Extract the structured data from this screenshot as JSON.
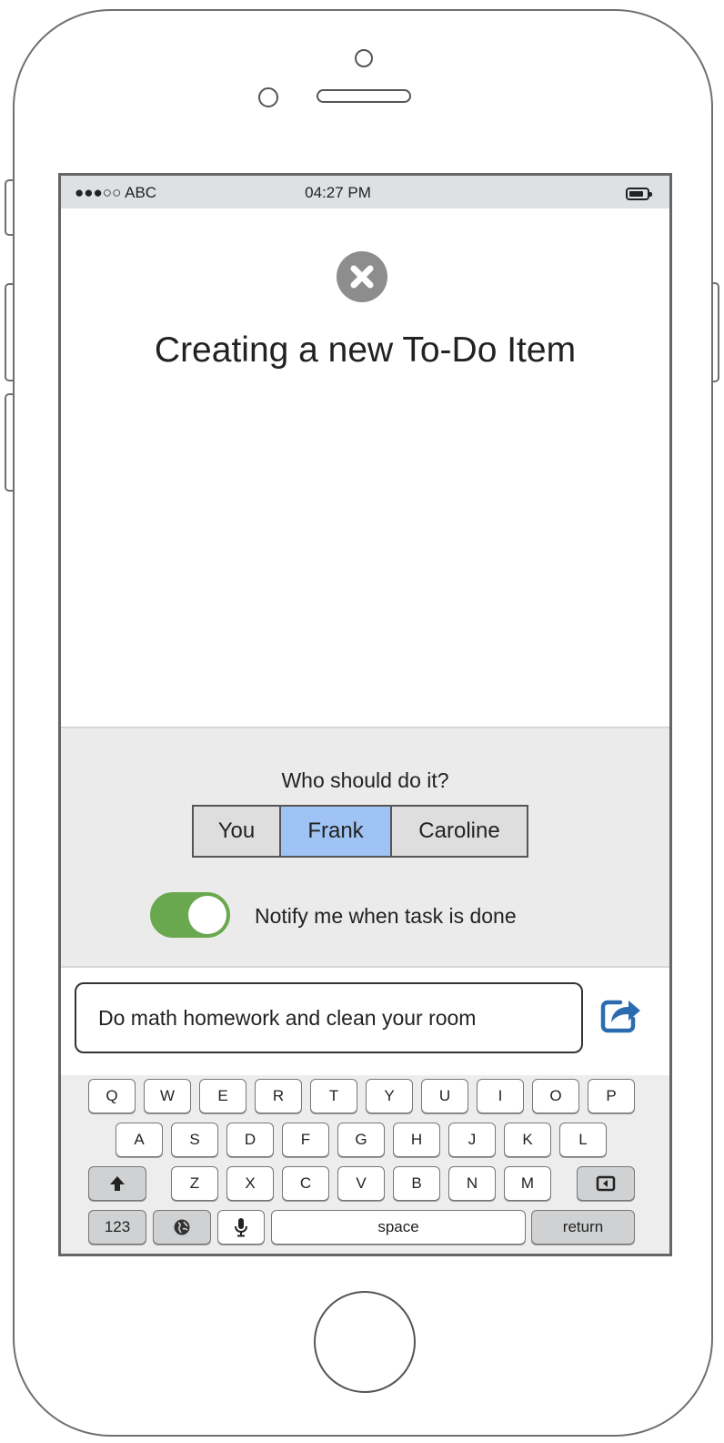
{
  "status_bar": {
    "carrier": "●●●○○ ABC",
    "time": "04:27 PM"
  },
  "title": "Creating a new To-Do Item",
  "assignment": {
    "prompt": "Who should do it?",
    "options": [
      "You",
      "Frank",
      "Caroline"
    ],
    "selected": "Frank"
  },
  "notify": {
    "label": "Notify me when task is done",
    "enabled": true
  },
  "task_input": {
    "value": "Do math homework and clean your room"
  },
  "keyboard": {
    "row1": [
      "Q",
      "W",
      "E",
      "R",
      "T",
      "Y",
      "U",
      "I",
      "O",
      "P"
    ],
    "row2": [
      "A",
      "S",
      "D",
      "F",
      "G",
      "H",
      "J",
      "K",
      "L"
    ],
    "row3": [
      "Z",
      "X",
      "C",
      "V",
      "B",
      "N",
      "M"
    ],
    "numbers_label": "123",
    "space_label": "space",
    "return_label": "return"
  },
  "icons": {
    "close": "close-icon",
    "send": "share-icon",
    "shift": "shift-arrow-icon",
    "backspace": "backspace-icon",
    "globe": "globe-icon",
    "mic": "microphone-icon"
  },
  "colors": {
    "selected_segment": "#9ec3f4",
    "toggle_on": "#6aa84f",
    "send_icon": "#2b6cb0"
  }
}
